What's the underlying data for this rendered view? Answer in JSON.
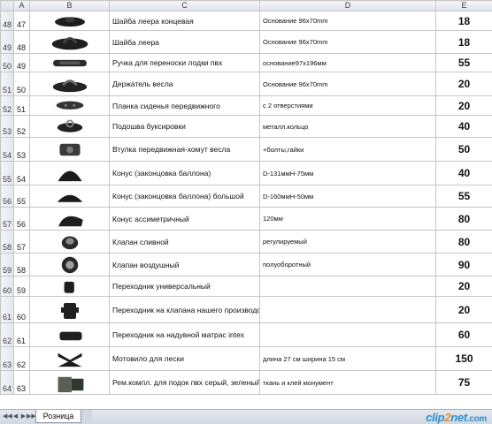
{
  "columns": [
    "A",
    "B",
    "C",
    "D",
    "E"
  ],
  "rows": [
    {
      "row": "48",
      "num": "47",
      "name": "Шайба леера концевая",
      "desc": "Основание 96х70mm",
      "price": "18",
      "icon": "end-rail-washer-icon"
    },
    {
      "row": "49",
      "num": "48",
      "name": "Шайба леера",
      "desc": "Основание 96х70mm",
      "price": "18",
      "icon": "rail-washer-icon"
    },
    {
      "row": "50",
      "num": "49",
      "name": "Ручка для переноски лодки пвх",
      "desc": "основание97х196мм",
      "price": "55",
      "icon": "carry-handle-icon"
    },
    {
      "row": "51",
      "num": "50",
      "name": "Держатель весла",
      "desc": "Основание 96х70mm",
      "price": "20",
      "icon": "oar-holder-icon"
    },
    {
      "row": "52",
      "num": "51",
      "name": "Планка сиденья передвижного",
      "desc": "с 2 отверстиями",
      "price": "20",
      "icon": "seat-bracket-icon"
    },
    {
      "row": "53",
      "num": "52",
      "name": "Подошва буксировки",
      "desc": "металл.кольцо",
      "price": "40",
      "icon": "towing-base-icon"
    },
    {
      "row": "54",
      "num": "53",
      "name": "Втулка передвижная-хомут весла",
      "desc": "+болты,гайки",
      "price": "50",
      "icon": "oar-clamp-icon"
    },
    {
      "row": "55",
      "num": "54",
      "name": "Конус (законцовка баллона)",
      "desc": "D-131ммН-75мм",
      "price": "40",
      "icon": "cone-icon"
    },
    {
      "row": "56",
      "num": "55",
      "name": "Конус (законцовка баллона) большой",
      "desc": "D-160ммН-50мм",
      "price": "55",
      "icon": "large-cone-icon"
    },
    {
      "row": "57",
      "num": "56",
      "name": "Конус ассиметричный",
      "desc": "120мм",
      "price": "80",
      "icon": "asymmetric-cone-icon"
    },
    {
      "row": "58",
      "num": "57",
      "name": "Клапан сливной",
      "desc": "регулируемый",
      "price": "80",
      "icon": "drain-valve-icon"
    },
    {
      "row": "59",
      "num": "58",
      "name": "Клапан воздушный",
      "desc": "полуоборотный",
      "price": "90",
      "icon": "air-valve-icon"
    },
    {
      "row": "60",
      "num": "59",
      "name": "Переходник универсальный",
      "desc": "",
      "price": "20",
      "icon": "universal-adapter-icon"
    },
    {
      "row": "61",
      "num": "60",
      "name": "Переходник на клапана нашего производства",
      "desc": "",
      "price": "20",
      "icon": "valve-adapter-icon"
    },
    {
      "row": "62",
      "num": "61",
      "name": "Переходник на надувной матрас intex",
      "desc": "",
      "price": "60",
      "icon": "mattress-adapter-icon"
    },
    {
      "row": "63",
      "num": "62",
      "name": "Мотовило для лески",
      "desc": "длина 27 см ширина 15 см",
      "price": "150",
      "icon": "line-winder-icon"
    },
    {
      "row": "64",
      "num": "63",
      "name": "Рем.компл. для подок пвх серый, зеленый",
      "desc": "ткань и клей монумент",
      "price": "75",
      "icon": "repair-kit-icon"
    }
  ],
  "sheet_tab": "Розница",
  "nav_buttons": [
    "◀◀",
    "◀",
    "▶",
    "▶▶"
  ],
  "watermark": {
    "part1": "clip",
    "part2": "2",
    "part3": "net",
    "part4": ".com"
  }
}
